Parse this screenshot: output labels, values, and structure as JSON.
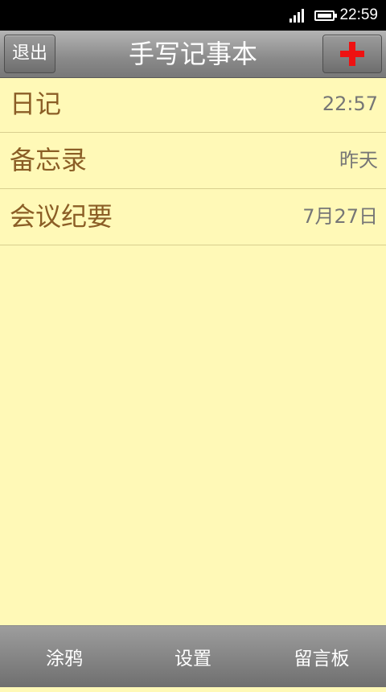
{
  "status_bar": {
    "time": "22:59",
    "signal_icon": "signal-icon",
    "battery_icon": "battery-icon"
  },
  "header": {
    "exit_label": "退出",
    "title": "手写记事本",
    "add_icon": "plus-icon",
    "add_icon_color": "#ee1111"
  },
  "notes": [
    {
      "title": "日记",
      "time": "22:57"
    },
    {
      "title": "备忘录",
      "time": "昨天"
    },
    {
      "title": "会议纪要",
      "time": "7月27日"
    }
  ],
  "bottom_bar": {
    "tabs": [
      {
        "label": "涂鸦"
      },
      {
        "label": "设置"
      },
      {
        "label": "留言板"
      }
    ]
  },
  "colors": {
    "background": "#fff9b7",
    "note_title": "#8b5e26",
    "note_time": "#767676"
  }
}
